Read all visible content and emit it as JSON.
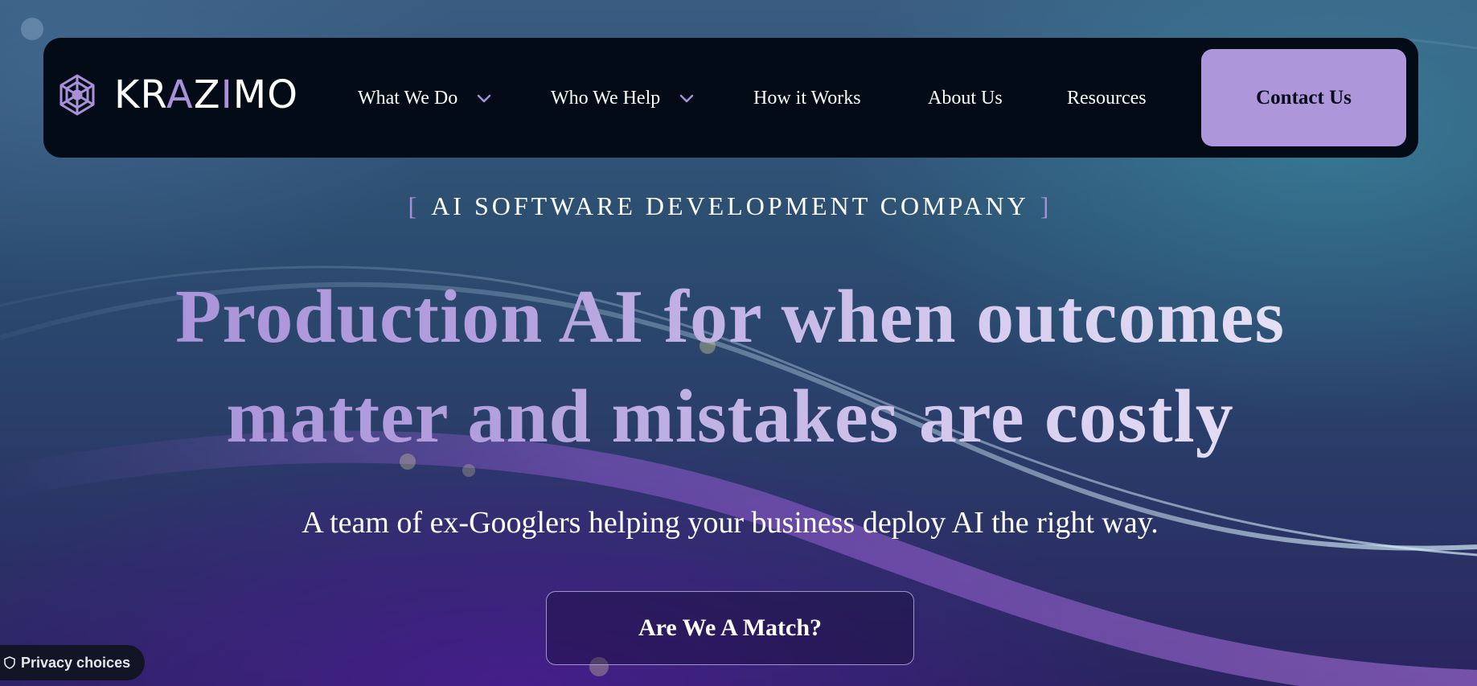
{
  "brand": {
    "name_prefix": "KR",
    "name_accent": "A",
    "name_mid": "Z",
    "name_accent2": "I",
    "name_suffix": "MO",
    "logo_icon": "snowflake-knot-icon",
    "accent_color": "#ad97da"
  },
  "nav": {
    "items": [
      {
        "label": "What We Do",
        "has_dropdown": true
      },
      {
        "label": "Who We Help",
        "has_dropdown": true
      },
      {
        "label": "How it Works",
        "has_dropdown": false
      },
      {
        "label": "About Us",
        "has_dropdown": false
      },
      {
        "label": "Resources",
        "has_dropdown": false
      }
    ],
    "contact_label": "Contact Us"
  },
  "hero": {
    "eyebrow_open": "[",
    "eyebrow": "AI SOFTWARE DEVELOPMENT COMPANY",
    "eyebrow_close": "]",
    "headline_line1": "Production AI for when outcomes",
    "headline_line2": "matter and mistakes are costly",
    "subtitle": "A team of ex-Googlers helping your business deploy AI the right way.",
    "cta_label": "Are We A Match?"
  },
  "privacy": {
    "label": "Privacy choices",
    "icon": "shield-icon"
  }
}
